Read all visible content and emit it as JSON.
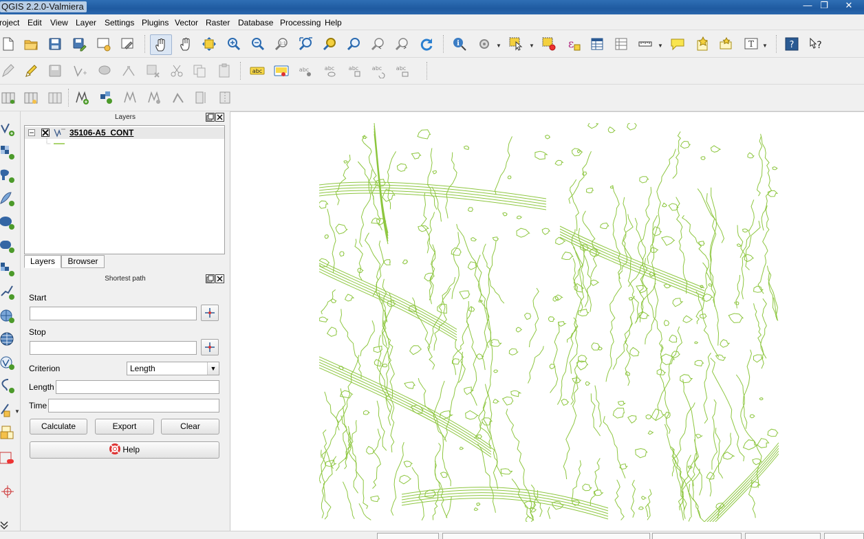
{
  "window": {
    "title": "QGIS 2.2.0-Valmiera",
    "controls": {
      "minimize": "—",
      "maximize": "❐",
      "close": "✕"
    }
  },
  "menubar": {
    "items": [
      "roject",
      "Edit",
      "View",
      "Layer",
      "Settings",
      "Plugins",
      "Vector",
      "Raster",
      "Database",
      "Processing",
      "Help"
    ]
  },
  "toolbar_icons": {
    "file": [
      "new-project-icon",
      "open-project-icon",
      "save-project-icon",
      "save-as-icon",
      "new-print-composer-icon",
      "composer-manager-icon"
    ],
    "navigation": [
      "touch-pan-icon",
      "pan-icon",
      "pan-to-selection-icon",
      "zoom-in-icon",
      "zoom-out-icon",
      "zoom-native-icon",
      "zoom-full-icon",
      "zoom-to-selection-icon",
      "zoom-to-layer-icon",
      "zoom-last-icon",
      "zoom-next-icon",
      "refresh-icon"
    ],
    "attributes": [
      "identify-icon",
      "action-icon",
      "select-icon",
      "deselect-icon",
      "expression-select-icon",
      "attribute-table-icon",
      "statistics-icon",
      "measure-icon",
      "map-tips-icon",
      "new-bookmark-icon",
      "show-bookmarks-icon",
      "text-annotation-icon",
      "help-icon",
      "whats-this-icon"
    ]
  },
  "label_toolbar": {
    "label_icon_text": "abc"
  },
  "layers_panel": {
    "title": "Layers",
    "layer_name": "35106-A5_CONT",
    "tabs": [
      "Layers",
      "Browser"
    ]
  },
  "shortest_path": {
    "title": "Shortest path",
    "start_label": "Start",
    "start_value": "",
    "stop_label": "Stop",
    "stop_value": "",
    "criterion_label": "Criterion",
    "criterion_value": "Length",
    "length_label": "Length",
    "length_value": "",
    "time_label": "Time",
    "time_value": "",
    "buttons": {
      "calculate": "Calculate",
      "export": "Export",
      "clear": "Clear",
      "help": "Help"
    }
  },
  "map": {
    "contour_color": "#8dc63f"
  },
  "colors": {
    "titlebar": "#1f5aa0",
    "panel_bg": "#f0f0f0",
    "canvas_bg": "#ffffff"
  }
}
